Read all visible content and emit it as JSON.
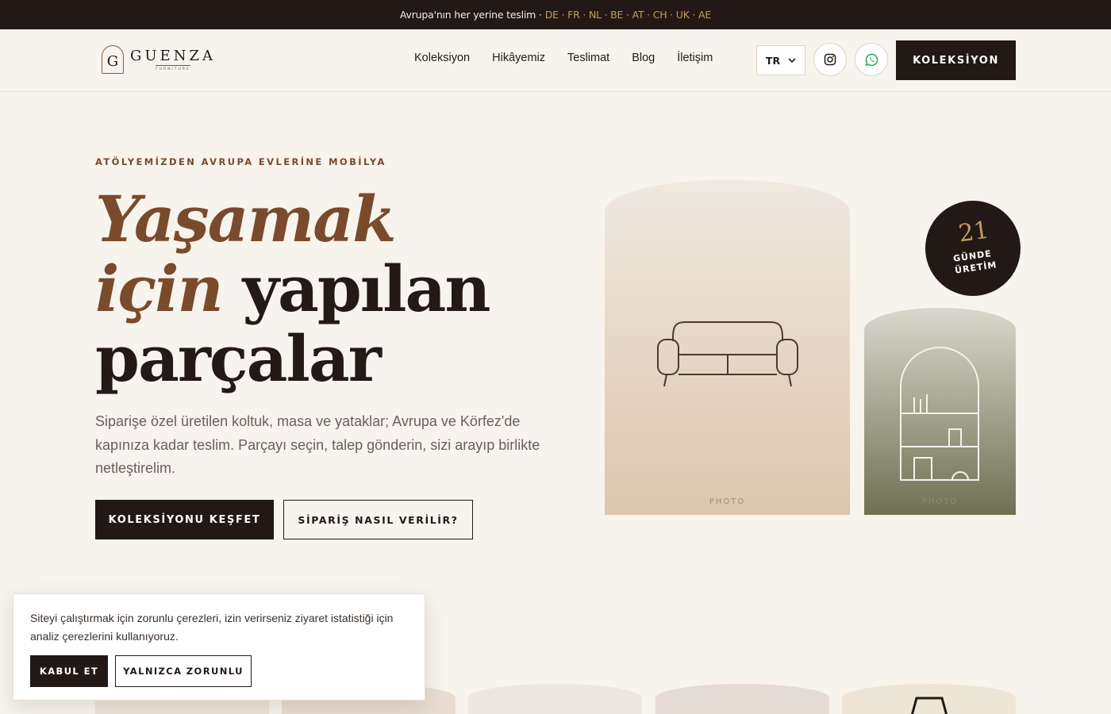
{
  "topbar": {
    "text": "Avrupa'nın her yerine teslim ·",
    "countries": "DE · FR · NL · BE · AT · CH · UK · AE"
  },
  "brand": {
    "initial": "G",
    "name": "GUENZA",
    "subtitle": "FURNITURE"
  },
  "nav": {
    "items": [
      {
        "label": "Koleksiyon"
      },
      {
        "label": "Hikâyemiz"
      },
      {
        "label": "Teslimat"
      },
      {
        "label": "Blog"
      },
      {
        "label": "İletişim"
      }
    ]
  },
  "header": {
    "language": "TR",
    "cta_label": "KOLEKSİYON",
    "icons": [
      "instagram-icon",
      "whatsapp-icon"
    ]
  },
  "hero": {
    "eyebrow": "ATÖLYEMİZDEN AVRUPA EVLERİNE MOBİLYA",
    "title_line1": "Yaşamak",
    "title_line2_accent": "için",
    "title_line2_rest": "yapılan",
    "title_line3": "parçalar",
    "description": "Siparişe özel üretilen koltuk, masa ve yataklar; Avrupa ve Körfez'de kapınıza kadar teslim. Parçayı seçin, talep gönderin, sizi arayıp birlikte netleştirelim.",
    "primary_button": "KOLEKSİYONU KEŞFET",
    "secondary_button": "SİPARİŞ NASIL VERİLİR?"
  },
  "gallery": {
    "photo_label_main": "PHOTO",
    "photo_label_side": "PHOTO",
    "badge_number": "21",
    "badge_line1": "GÜNDE",
    "badge_line2": "ÜRETİM"
  },
  "cookie": {
    "text": "Siteyi çalıştırmak için zorunlu çerezleri, izin verirseniz ziyaret istatistiği için analiz çerezlerini kullanıyoruz.",
    "accept_label": "KABUL ET",
    "essential_label": "YALNIZCA ZORUNLU"
  },
  "colors": {
    "dark": "#221916",
    "accent_brown": "#7a4a2c",
    "gold": "#c49a5e",
    "background": "#f7f3ed"
  }
}
